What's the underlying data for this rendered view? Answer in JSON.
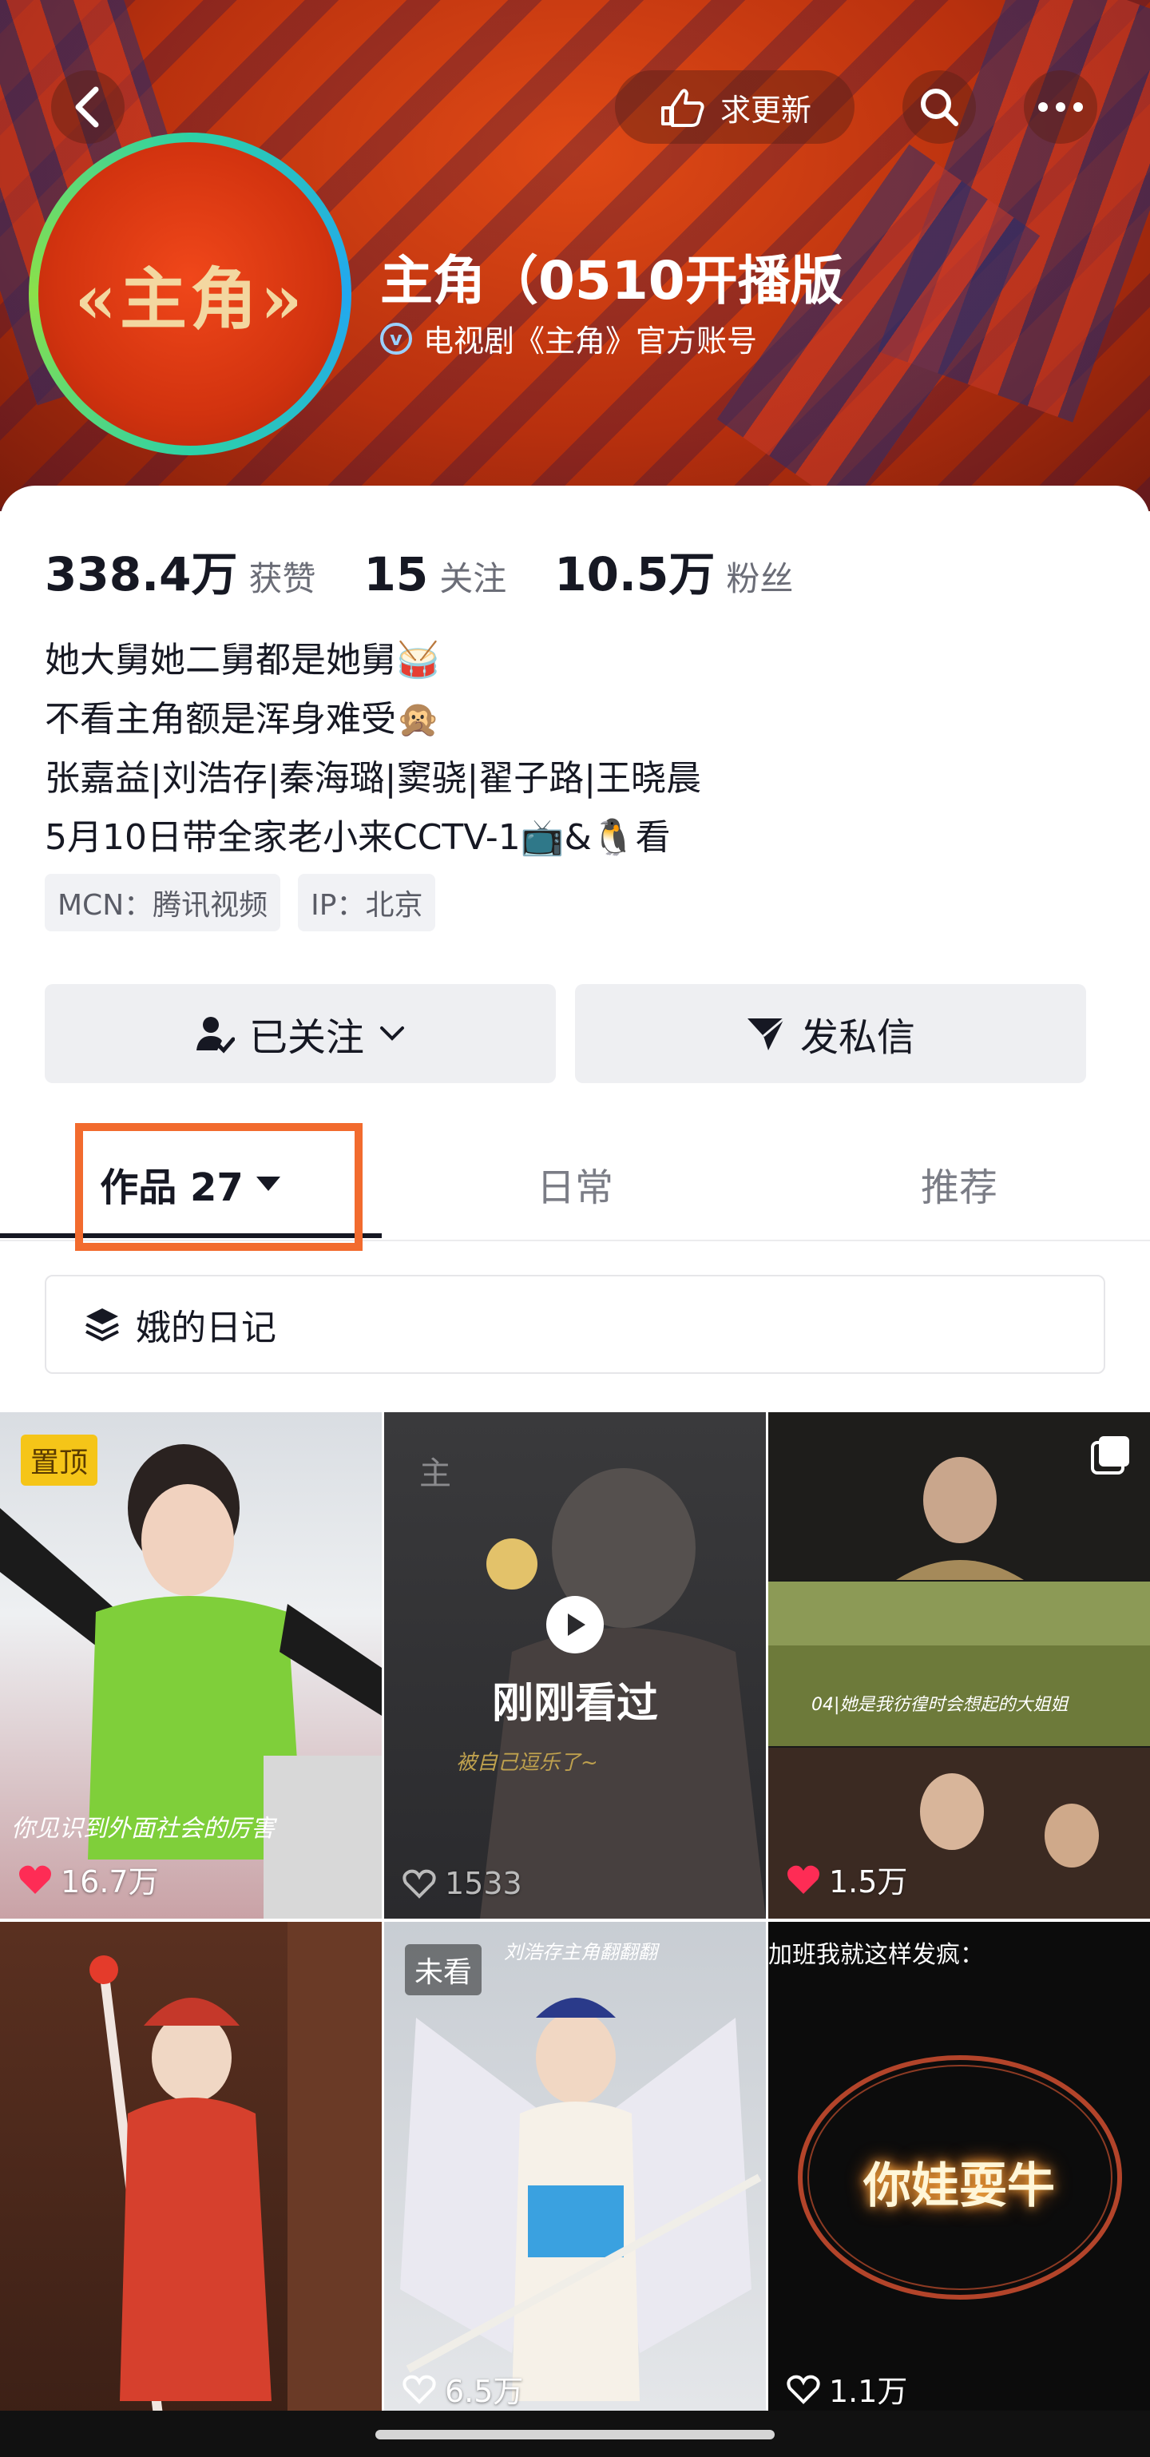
{
  "header": {
    "back_icon": "back-arrow-icon",
    "request_update_label": "求更新",
    "search_icon": "search-icon",
    "more_icon": "more-dots-icon"
  },
  "profile": {
    "avatar_text": "«主角»",
    "title": "主角（0510开播版",
    "verify_text": "电视剧《主角》官方账号"
  },
  "stats": {
    "likes_value": "338.4万",
    "likes_label": "获赞",
    "following_value": "15",
    "following_label": "关注",
    "followers_value": "10.5万",
    "followers_label": "粉丝"
  },
  "bio": {
    "line1": "她大舅她二舅都是她舅🥁",
    "line2": "不看主角额是浑身难受🙊",
    "line3": "张嘉益|刘浩存|秦海璐|窦骁|翟子路|王晓晨",
    "line4": "5月10日带全家老小来CCTV-1📺&🐧看"
  },
  "tags": {
    "mcn": "MCN：腾讯视频",
    "ip": "IP：北京"
  },
  "actions": {
    "follow_label": "已关注",
    "message_label": "发私信"
  },
  "tabs": {
    "works": "作品 27",
    "daily": "日常",
    "recommend": "推荐"
  },
  "collection": {
    "label": "娥的日记"
  },
  "videos": [
    {
      "badge": "置顶",
      "caption": "你见识到外面社会的厉害",
      "likes": "16.7万",
      "liked": true
    },
    {
      "overlay": "刚刚看过",
      "caption": "被自己逗乐了~",
      "likes": "1533",
      "liked": false
    },
    {
      "caption": "04|她是我彷徨时会想起的大姐姐",
      "likes": "1.5万",
      "liked": true
    },
    {
      "likes": "",
      "liked": false
    },
    {
      "badge": "未看",
      "caption": "刘浩存主角翻翻翻",
      "likes": "6.5万",
      "liked": false
    },
    {
      "caption_top": "加班我就这样发疯：",
      "center_text": "你娃耍牛",
      "likes": "1.1万",
      "liked": false
    }
  ],
  "colors": {
    "banner": "#c8360f",
    "highlight": "#f26b2e",
    "like_red": "#fe2c55",
    "pin_badge": "#f5c518"
  }
}
